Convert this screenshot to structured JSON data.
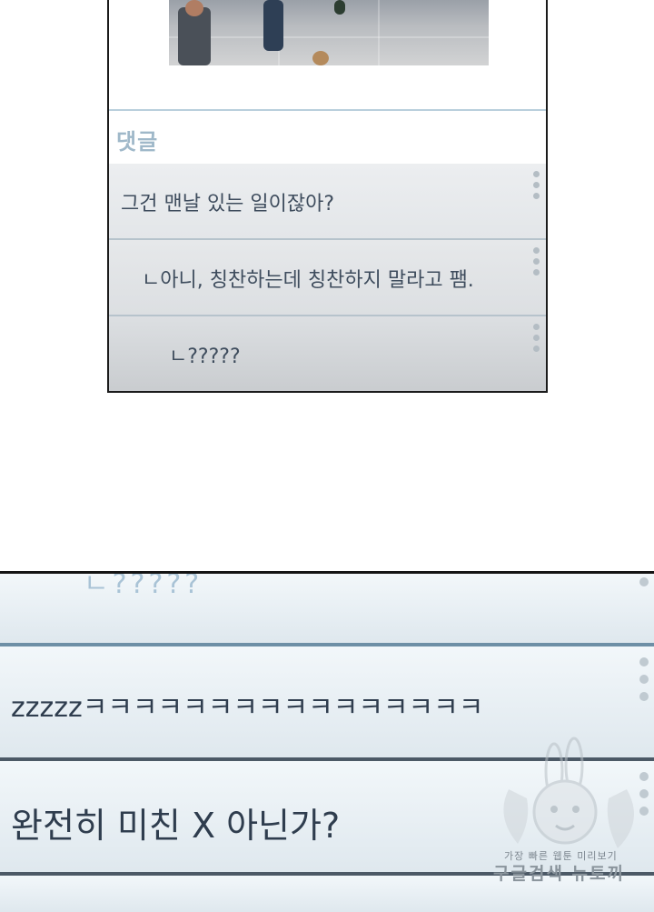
{
  "panel_top": {
    "comment_header": "댓글",
    "comments": [
      {
        "text": "그건 맨날 있는 일이잖아?"
      },
      {
        "text": "ㄴ아니, 칭찬하는데 칭찬하지 말라고 팸."
      },
      {
        "text": "ㄴ?????"
      }
    ]
  },
  "panel_zoom": {
    "comments": [
      {
        "text": "ㄴ?????"
      },
      {
        "text": "zzzzzㅋㅋㅋㅋㅋㅋㅋㅋㅋㅋㅋㅋㅋㅋㅋㅋ"
      },
      {
        "text": "완전히 미친 X 아닌가?"
      }
    ]
  },
  "watermark": {
    "line1": "가장 빠른 웹툰 미리보기",
    "line2": "구글검색 뉴토끼"
  },
  "colors": {
    "comment_text": "#3e4c5d",
    "header_text": "#9fb8c9",
    "separator_blue": "#6e8fa6",
    "panel_border": "#1b1b1b"
  }
}
